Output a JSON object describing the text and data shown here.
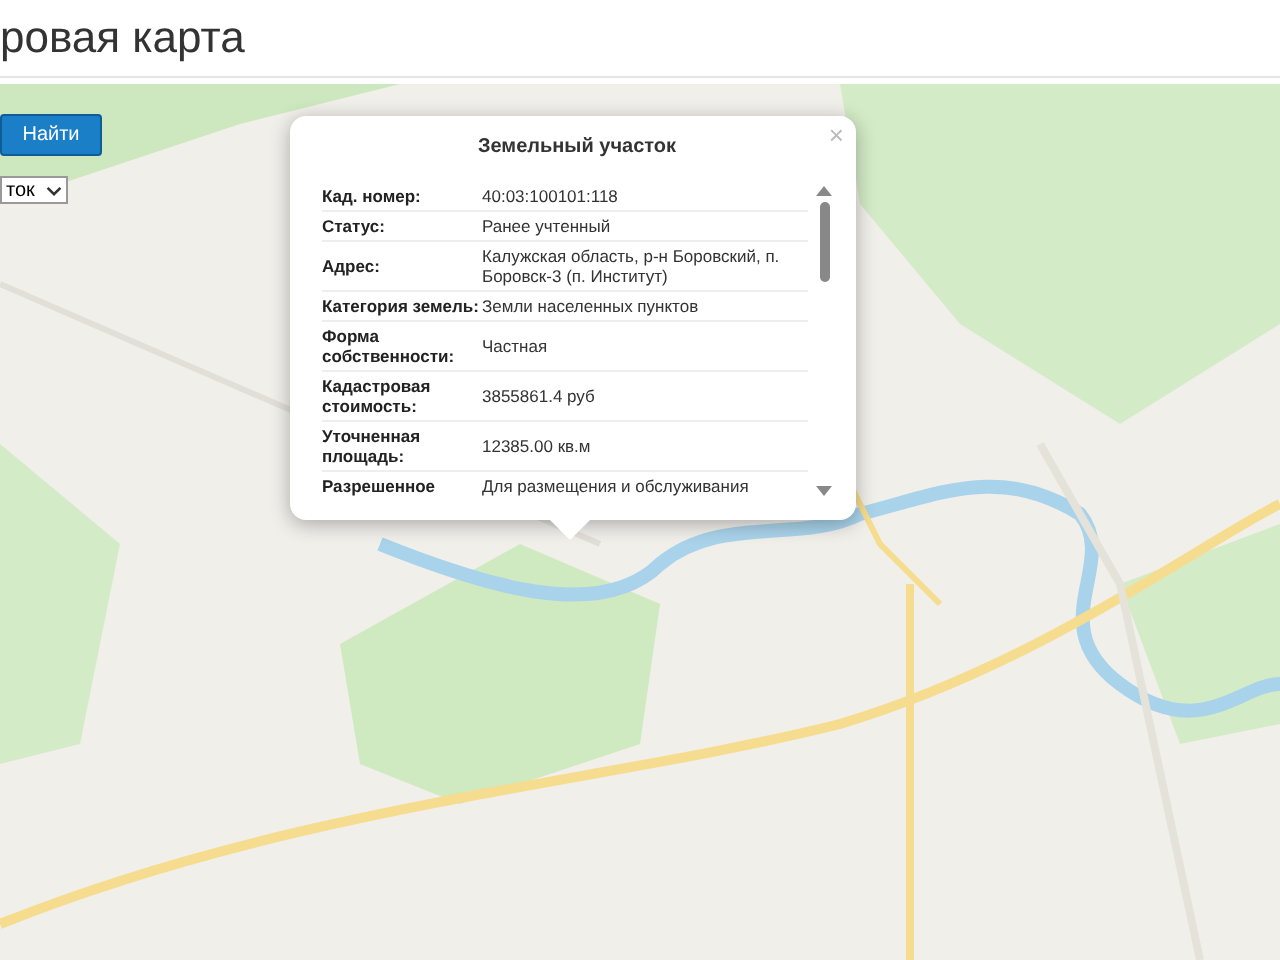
{
  "page": {
    "title": "ровая карта"
  },
  "search_button": {
    "label": "Найти"
  },
  "select": {
    "value": "ток"
  },
  "popup": {
    "title": "Земельный участок",
    "close": "×",
    "rows": [
      {
        "label": "Кад. номер:",
        "value": "40:03:100101:118"
      },
      {
        "label": "Статус:",
        "value": "Ранее учтенный"
      },
      {
        "label": "Адрес:",
        "value": "Калужская область, р-н Боровский, п. Боровск-3 (п. Институт)"
      },
      {
        "label": "Категория земель:",
        "value": "Земли населенных пунктов"
      },
      {
        "label": "Форма собственности:",
        "value": "Частная"
      },
      {
        "label": "Кадастровая стоимость:",
        "value": "3855861.4 руб"
      },
      {
        "label": "Уточненная площадь:",
        "value": "12385.00 кв.м"
      },
      {
        "label": "Разрешенное",
        "value": "Для размещения и обслуживания"
      }
    ]
  }
}
